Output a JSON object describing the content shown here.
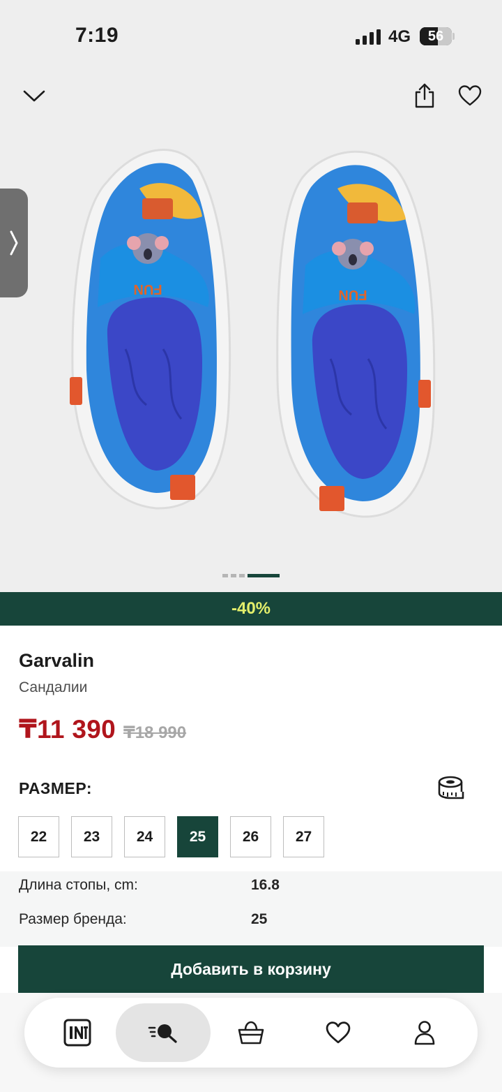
{
  "status_bar": {
    "time": "7:19",
    "network": "4G",
    "battery_percent": 56,
    "battery_label": "56"
  },
  "carousel": {
    "slide_count": 4,
    "active_index": 3
  },
  "product": {
    "discount_label": "-40%",
    "brand": "Garvalin",
    "category": "Сандалии",
    "price": "₸11 390",
    "old_price": "₸18 990"
  },
  "size_section": {
    "title": "РАЗМЕР:",
    "sizes": [
      "22",
      "23",
      "24",
      "25",
      "26",
      "27"
    ],
    "selected": "25"
  },
  "specs": {
    "foot_length_label": "Длина стопы, cm:",
    "foot_length_value": "16.8",
    "brand_size_label": "Размер бренда:",
    "brand_size_value": "25"
  },
  "cart_button": "Добавить в корзину",
  "tabbar": {
    "items": [
      "home-logo-icon",
      "search-icon",
      "basket-icon",
      "heart-icon",
      "profile-icon"
    ],
    "active": "search-icon"
  },
  "colors": {
    "brand_green": "#17453a",
    "discount_text": "#e4ef6b",
    "price_red": "#b0151c"
  }
}
